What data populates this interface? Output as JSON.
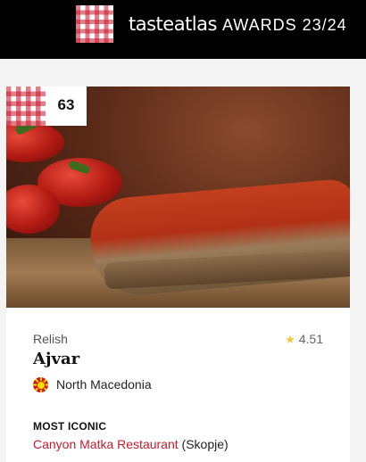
{
  "header": {
    "brand_bold": "tasteatlas",
    "brand_awards": "AWARDS 23/24",
    "logo_icon": "checkered-tablecloth-icon"
  },
  "card": {
    "rank": "63",
    "category": "Relish",
    "rating": "4.51",
    "rating_icon": "star-icon",
    "dish_name": "Ajvar",
    "country": "North Macedonia",
    "country_flag_icon": "north-macedonia-flag-icon",
    "most_iconic_label": "MOST ICONIC",
    "restaurant": "Canyon Matka Restaurant",
    "restaurant_city": "(Skopje)",
    "image_alt": "ajvar-on-bread-photo"
  },
  "colors": {
    "brand_red": "#c21d2b",
    "star_yellow": "#f2c541",
    "header_bg": "#000000"
  }
}
